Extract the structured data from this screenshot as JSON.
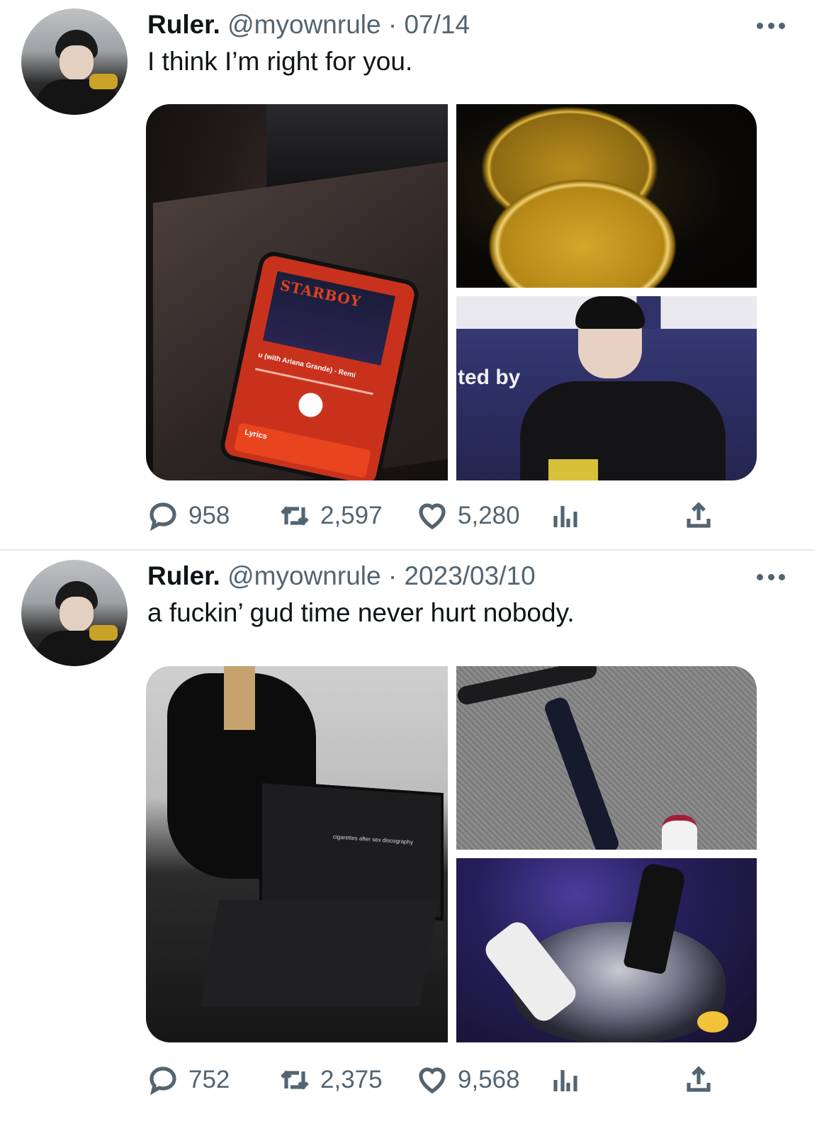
{
  "tweets": [
    {
      "author_name": "Ruler.",
      "handle": "@myownrule",
      "separator": "·",
      "date": "07/14",
      "text": "I think I’m right for you.",
      "photos": {
        "left_album_title": "STARBOY",
        "left_track": "u (with Ariana Grande) - Remi",
        "left_lyrics_label": "Lyrics",
        "right_bottom_sign": "ted by"
      },
      "replies": "958",
      "retweets": "2,597",
      "likes": "5,280"
    },
    {
      "author_name": "Ruler.",
      "handle": "@myownrule",
      "separator": "·",
      "date": "2023/03/10",
      "text": "a fuckin’ gud time never hurt nobody.",
      "photos": {
        "left_screen_text": "cigarettes after sex discography"
      },
      "replies": "752",
      "retweets": "2,375",
      "likes": "9,568"
    }
  ],
  "icons": {
    "reply": "reply-icon",
    "retweet": "retweet-icon",
    "like": "heart-icon",
    "views": "views-icon",
    "share": "share-icon",
    "more": "more-icon"
  },
  "colors": {
    "text": "#0f1419",
    "secondary": "#536471",
    "divider": "#e6e9ec",
    "background": "#ffffff"
  }
}
